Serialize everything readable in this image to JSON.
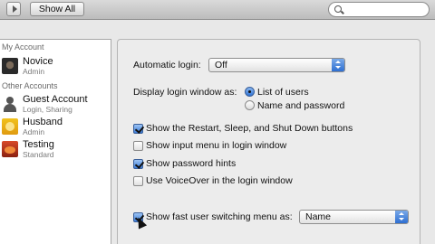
{
  "toolbar": {
    "show_all_label": "Show All",
    "search_placeholder": ""
  },
  "sidebar": {
    "my_account_header": "My Account",
    "other_accounts_header": "Other Accounts",
    "my_account": {
      "name": "Novice",
      "role": "Admin"
    },
    "others": [
      {
        "name": "Guest Account",
        "role": "Login, Sharing"
      },
      {
        "name": "Husband",
        "role": "Admin"
      },
      {
        "name": "Testing",
        "role": "Standard"
      }
    ]
  },
  "login": {
    "automatic_login_label": "Automatic login:",
    "automatic_login_value": "Off",
    "display_window_label": "Display login window as:",
    "radio_list_label": "List of users",
    "radio_name_label": "Name and password",
    "radio_selected": "List of users",
    "options": [
      {
        "label": "Show the Restart, Sleep, and Shut Down buttons",
        "checked": true
      },
      {
        "label": "Show input menu in login window",
        "checked": false
      },
      {
        "label": "Show password hints",
        "checked": true
      },
      {
        "label": "Use VoiceOver in the login window",
        "checked": false
      }
    ],
    "fast_switch_label": "Show fast user switching menu as:",
    "fast_switch_checked": true,
    "fast_switch_value": "Name"
  }
}
